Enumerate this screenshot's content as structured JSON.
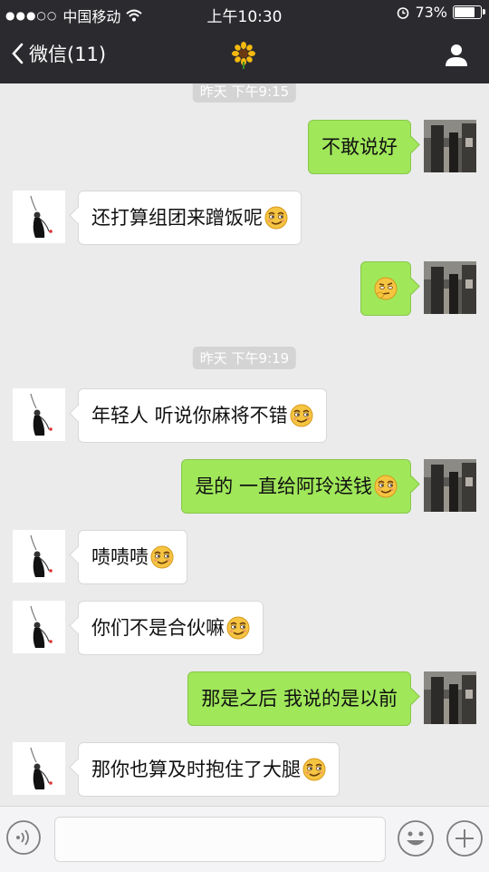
{
  "status_bar": {
    "carrier": "中国移动",
    "time": "上午10:30",
    "battery_percent": "73%",
    "signal_icon": "signal-dots-icon",
    "wifi_icon": "wifi-icon",
    "alarm_icon": "alarm-clock-icon"
  },
  "nav": {
    "back_label": "微信(11)",
    "title_icon": "sunflower-icon",
    "profile_icon": "person-icon"
  },
  "timestamps": [
    "昨天 下午9:15",
    "昨天 下午9:19"
  ],
  "messages": [
    {
      "side": "right",
      "text": "不敢说好",
      "emoji": ""
    },
    {
      "side": "left",
      "text": "还打算组团来蹭饭呢",
      "emoji": "smirk-emoji"
    },
    {
      "side": "right",
      "text": "",
      "emoji": "thinking-emoji"
    },
    {
      "side": "left",
      "text": "年轻人 听说你麻将不错",
      "emoji": "smirk-emoji"
    },
    {
      "side": "right",
      "text": "是的 一直给阿玲送钱",
      "emoji": "smirk-emoji"
    },
    {
      "side": "left",
      "text": "啧啧啧",
      "emoji": "smirk-emoji"
    },
    {
      "side": "left",
      "text": "你们不是合伙嘛",
      "emoji": "smirk-emoji"
    },
    {
      "side": "right",
      "text": "那是之后 我说的是以前",
      "emoji": ""
    },
    {
      "side": "left",
      "text": "那你也算及时抱住了大腿",
      "emoji": "smirk-emoji"
    }
  ],
  "input_bar": {
    "voice_icon": "voice-icon",
    "emoji_icon": "emoji-face-icon",
    "plus_icon": "plus-icon",
    "message_placeholder": ""
  },
  "colors": {
    "nav_bg": "#2b2b2f",
    "chat_bg": "#ebebeb",
    "sent_bubble": "#a0e75a",
    "received_bubble": "#ffffff"
  }
}
